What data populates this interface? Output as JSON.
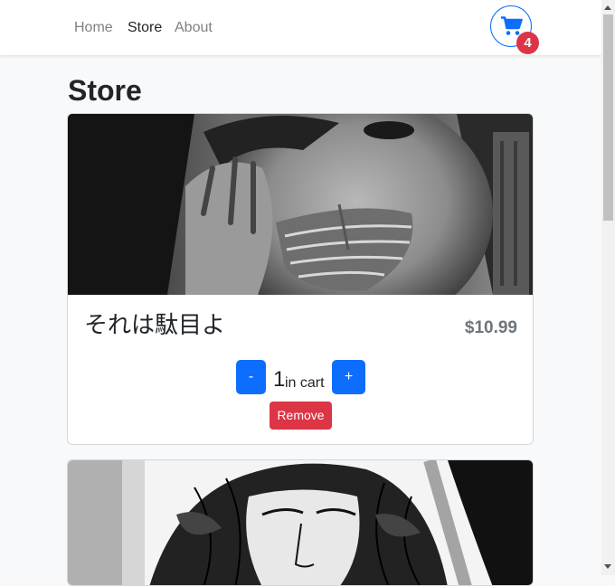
{
  "nav": {
    "links": [
      {
        "label": "Home"
      },
      {
        "label": "Store"
      },
      {
        "label": "About"
      }
    ],
    "cart_count": "4"
  },
  "page": {
    "title": "Store"
  },
  "products": [
    {
      "name": "それは駄目よ",
      "price": "$10.99",
      "quantity": "1",
      "quantity_suffix": "in cart",
      "decrement_label": "-",
      "increment_label": "+",
      "remove_label": "Remove",
      "image": "grayscale-portrait-with-mask"
    },
    {
      "image": "ink-sketch-portrait"
    }
  ],
  "colors": {
    "primary": "#0d6efd",
    "danger": "#dc3545",
    "muted": "#6c757d",
    "background": "#f8f9fa"
  }
}
